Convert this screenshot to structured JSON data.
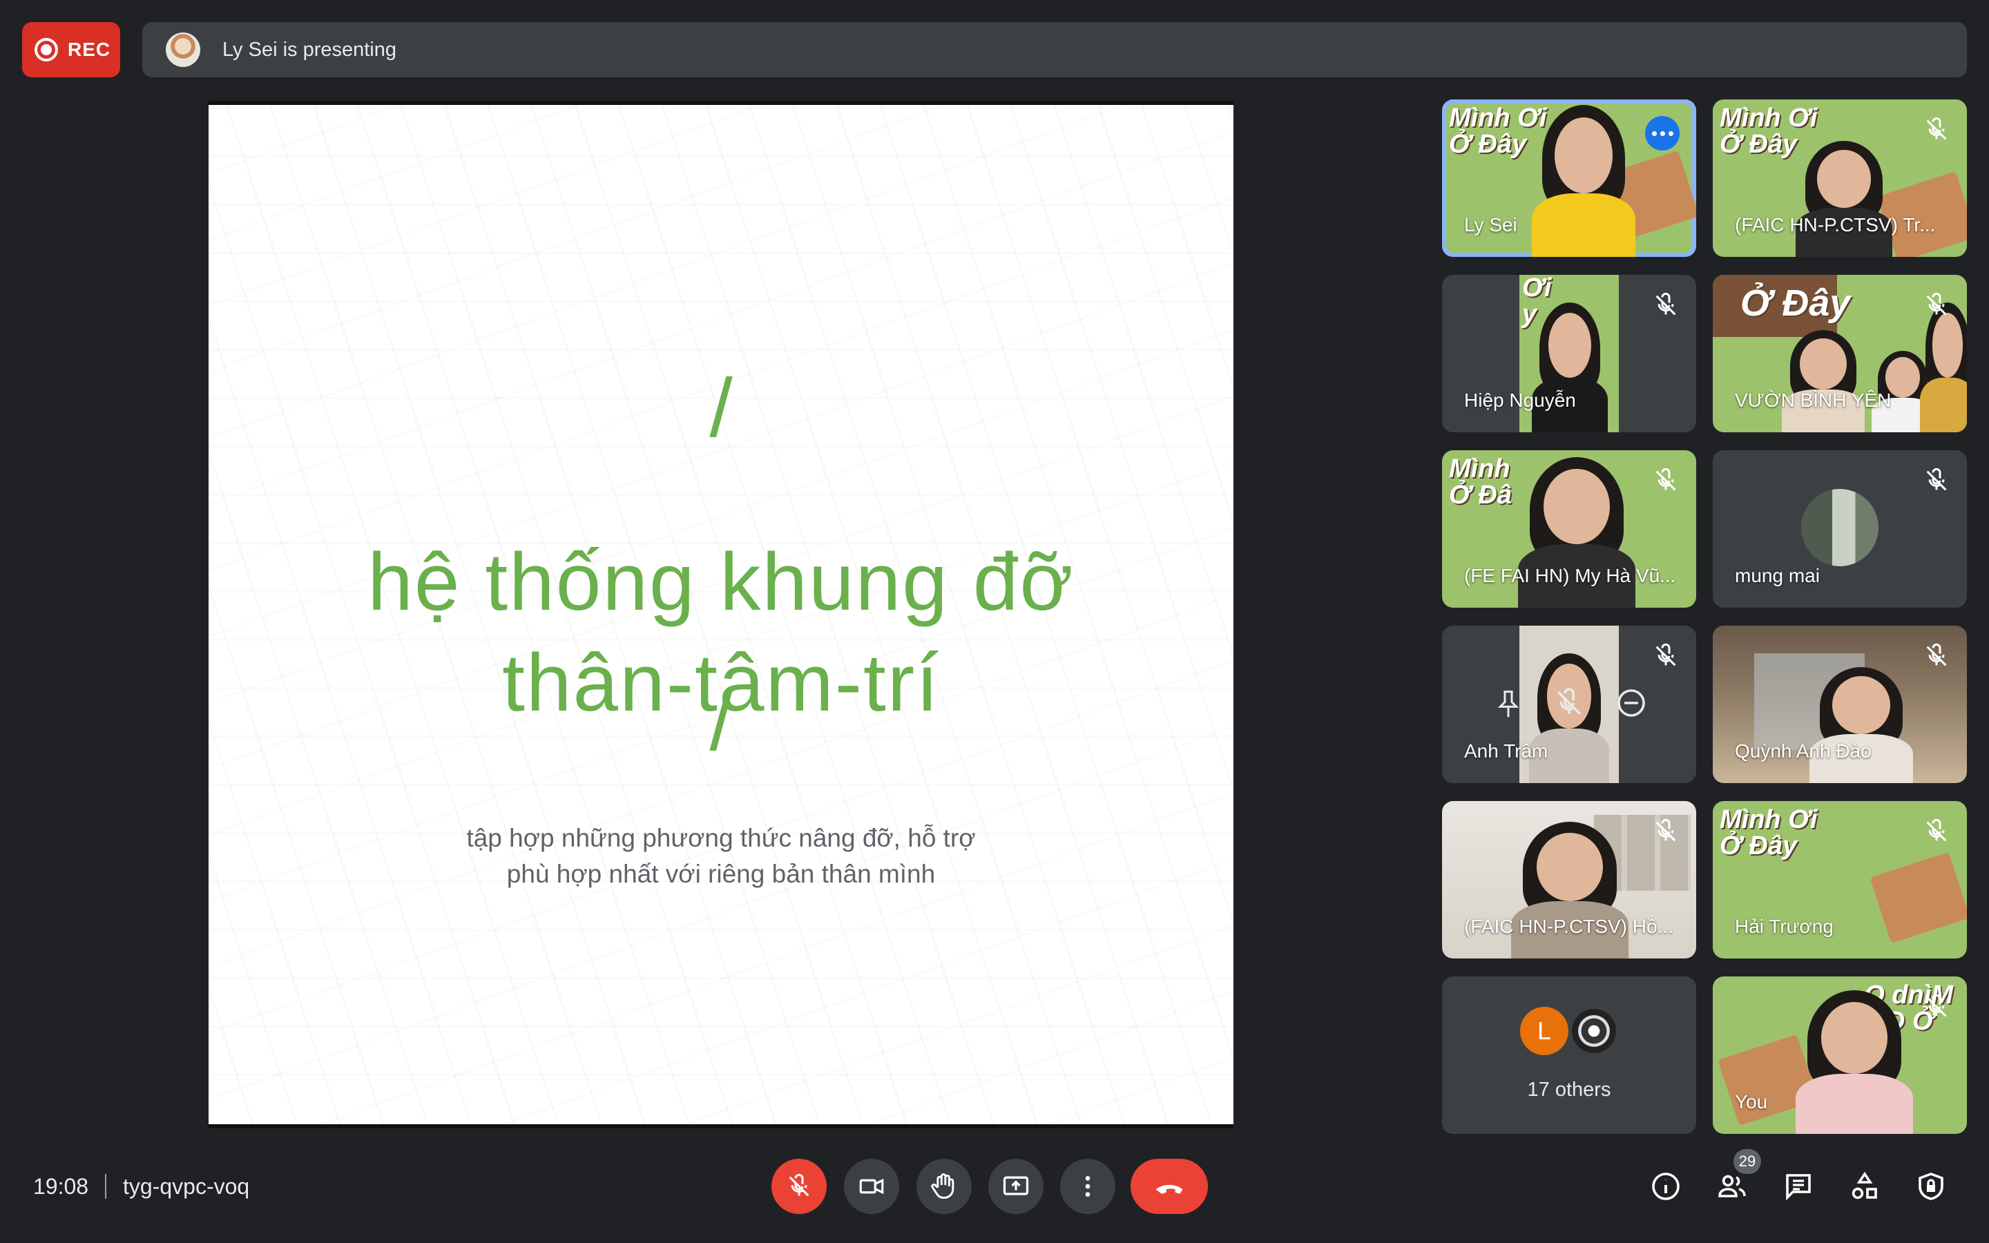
{
  "recording": {
    "label": "REC"
  },
  "presenting": {
    "text": "Ly Sei is presenting"
  },
  "slide": {
    "slash_top": "/",
    "title_line1": "hệ thống khung đỡ",
    "title_line2": "thân-tâm-trí",
    "slash_bottom": "/",
    "subtitle_line1": "tập hợp những phương thức nâng đỡ, hỗ trợ",
    "subtitle_line2": "phù hợp nhất với riêng bản thân mình",
    "title_color": "#6ab04c"
  },
  "participants": [
    {
      "name": "Ly Sei",
      "banner": [
        "Mình Ơi",
        "Ở Đây"
      ],
      "active": true,
      "muted": false
    },
    {
      "name": "(FAIC HN-P.CTSV) Tr...",
      "banner": [
        "Mình Ơi",
        "Ở Đây"
      ],
      "muted": true
    },
    {
      "name": "Hiệp Nguyễn",
      "banner": [
        "Ơi",
        "y"
      ],
      "muted": true
    },
    {
      "name": "VƯỜN BÌNH YÊN",
      "banner": [
        "Ở Đây"
      ],
      "muted": true
    },
    {
      "name": "(FE FAI HN) My Hà Vũ...",
      "banner": [
        "Mình",
        "Ở Đâ"
      ],
      "muted": true
    },
    {
      "name": "mung mai",
      "muted": true
    },
    {
      "name": "Anh Trâm",
      "muted": true
    },
    {
      "name": "Quỳnh Anh Đào",
      "muted": true
    },
    {
      "name": "(FAIC HN-P.CTSV) Hồ...",
      "muted": true
    },
    {
      "name": "Hải Trương",
      "banner": [
        "Mình Ơi",
        "Ở Đây"
      ],
      "muted": true
    },
    {
      "name": "You",
      "banner": [
        "O dnìM",
        "iêĐ Ở"
      ],
      "muted": true
    }
  ],
  "others": {
    "avatar_letter": "L",
    "label": "17 others"
  },
  "meeting": {
    "time": "19:08",
    "code": "tyg-qvpc-voq"
  },
  "people_count": "29",
  "colors": {
    "accent": "#8ab4f8",
    "danger": "#ea4335",
    "rec": "#d93025",
    "surface": "#3c4043",
    "background": "#202124"
  }
}
